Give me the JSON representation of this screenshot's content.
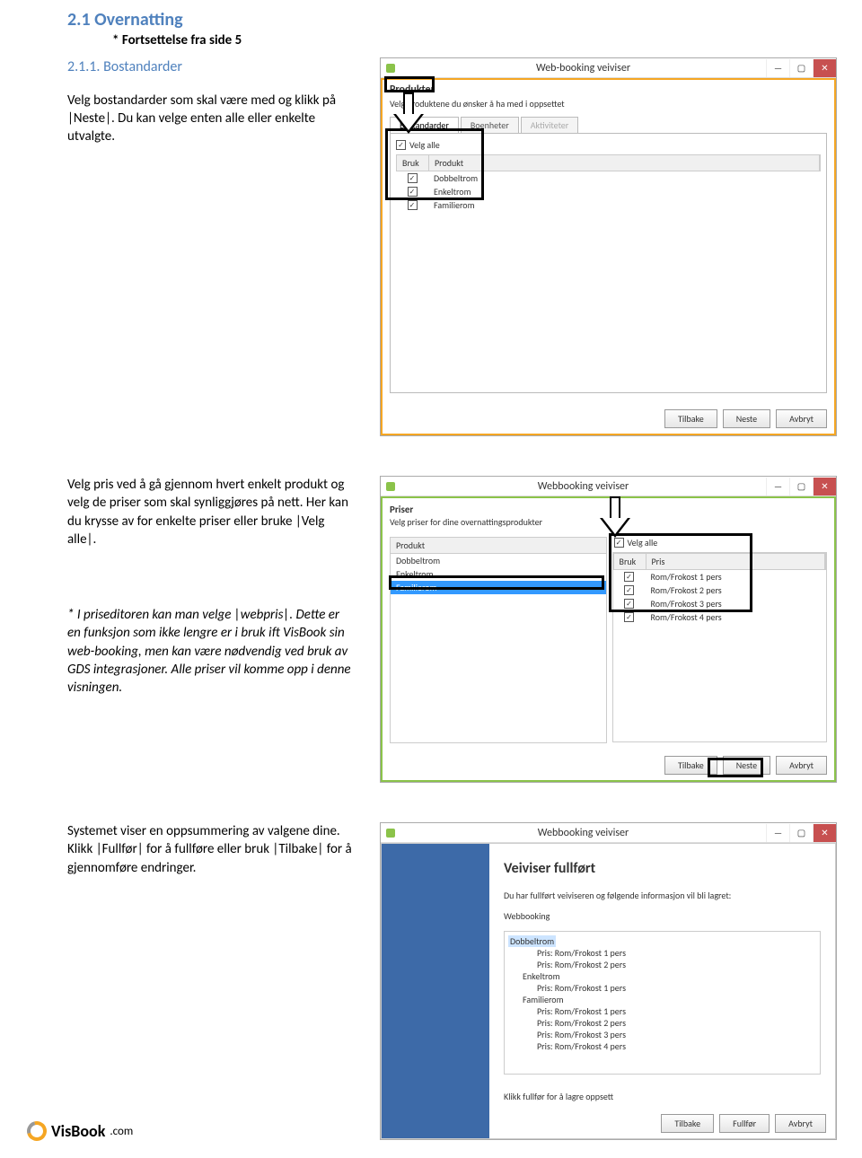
{
  "doc": {
    "section_title": "2.1 Overnatting",
    "cont_note": "* Fortsettelse fra side 5",
    "subheading": "2.1.1. Bostandarder",
    "p1": "Velg bostandarder som skal være med og klikk på |Neste|. Du kan velge enten alle eller enkelte utvalgte.",
    "p2": "Velg pris ved å gå gjennom hvert enkelt produkt og velg de priser som skal synliggjøres på nett. Her kan du krysse av for enkelte priser eller bruke |Velg alle|.",
    "p3": "* I priseditoren kan man velge |webpris|. Dette er en funksjon som ikke lengre er i bruk ift VisBook sin web-booking, men kan være nødvendig ved bruk av GDS integrasjoner. Alle priser vil komme opp i denne visningen.",
    "p4": "Systemet viser en oppsummering av valgene dine. Klikk |Fullfør| for å fullføre eller bruk |Tilbake| for å gjennomføre endringer.",
    "footer_brand": "VisBook",
    "footer_tld": ".com"
  },
  "win1": {
    "title": "Web-booking veiviser",
    "heading": "Produkter",
    "subtext": "Velg produktene du ønsker å ha med i oppsettet",
    "tabs": [
      "Bostandarder",
      "Boenheter",
      "Aktiviteter"
    ],
    "velg_alle": "Velg alle",
    "col_bruk": "Bruk",
    "col_produkt": "Produkt",
    "rows": [
      "Dobbeltrom",
      "Enkeltrom",
      "Familierom"
    ],
    "btn_back": "Tilbake",
    "btn_next": "Neste",
    "btn_cancel": "Avbryt"
  },
  "win2": {
    "title": "Webbooking veiviser",
    "heading": "Priser",
    "subtext": "Velg priser for dine overnattingsprodukter",
    "left_header": "Produkt",
    "left_rows": [
      "Dobbeltrom",
      "Enkeltrom",
      "Familierom"
    ],
    "velg_alle": "Velg alle",
    "right_col_bruk": "Bruk",
    "right_col_pris": "Pris",
    "right_rows": [
      "Rom/Frokost 1 pers",
      "Rom/Frokost 2 pers",
      "Rom/Frokost 3 pers",
      "Rom/Frokost 4 pers"
    ],
    "btn_back": "Tilbake",
    "btn_next": "Neste",
    "btn_cancel": "Avbryt"
  },
  "win3": {
    "title": "Webbooking veiviser",
    "heading": "Veiviser fullført",
    "text1": "Du har fullført veiviseren og følgende informasjon vil bli lagret:",
    "text2": "Webbooking",
    "tree": {
      "n0": "Dobbeltrom",
      "n0c": [
        "Pris: Rom/Frokost 1 pers",
        "Pris: Rom/Frokost 2 pers"
      ],
      "n1": "Enkeltrom",
      "n1c": [
        "Pris: Rom/Frokost 1 pers"
      ],
      "n2": "Familierom",
      "n2c": [
        "Pris: Rom/Frokost 1 pers",
        "Pris: Rom/Frokost 2 pers",
        "Pris: Rom/Frokost 3 pers",
        "Pris: Rom/Frokost 4 pers"
      ]
    },
    "note": "Klikk fullfør for å lagre oppsett",
    "btn_back": "Tilbake",
    "btn_finish": "Fullfør",
    "btn_cancel": "Avbryt"
  }
}
